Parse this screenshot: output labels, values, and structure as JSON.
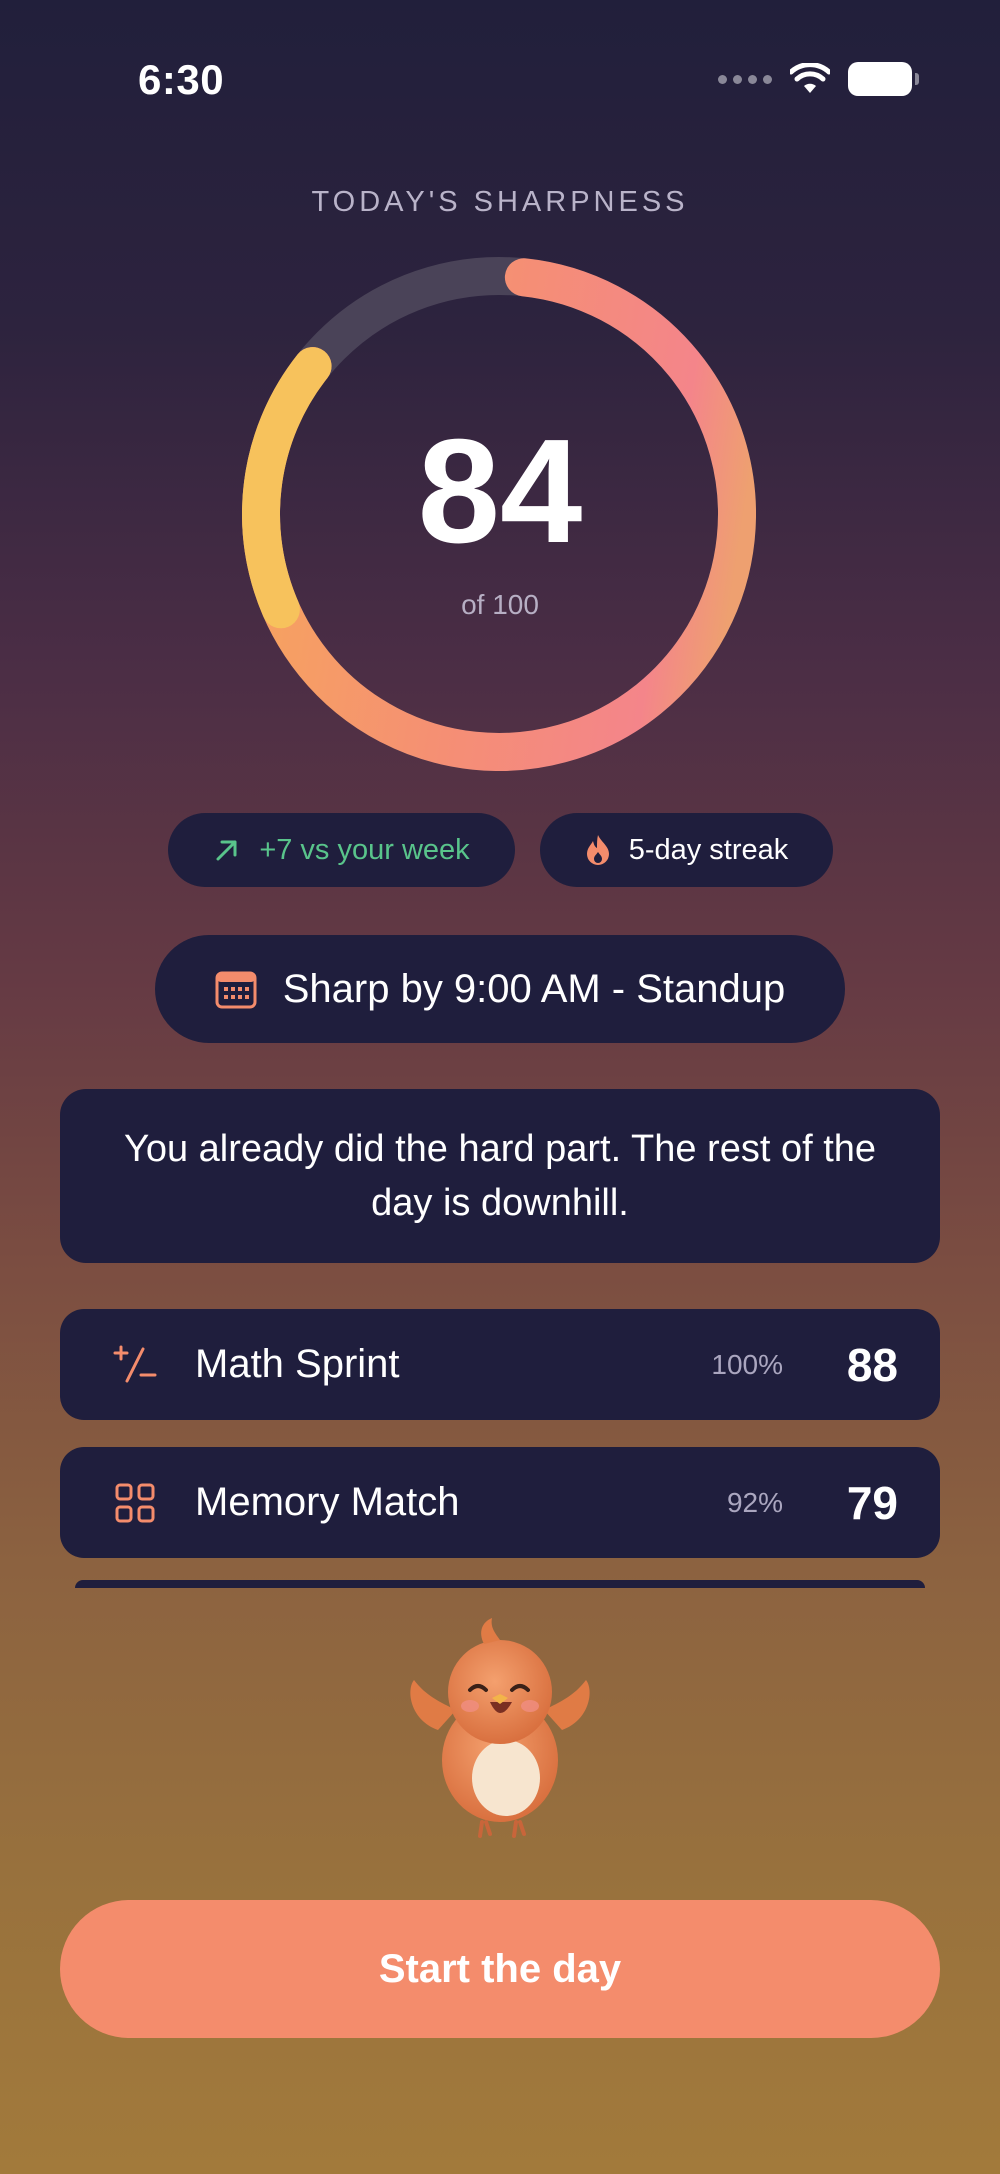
{
  "status_bar": {
    "time": "6:30",
    "icons": [
      "signal-dots-icon",
      "wifi-icon",
      "battery-icon"
    ]
  },
  "header": {
    "title": "TODAY'S SHARPNESS"
  },
  "score": {
    "value": "84",
    "subtitle": "of 100",
    "fraction": 0.84
  },
  "badges": {
    "trend": {
      "icon": "arrow-up-right-icon",
      "label": "+7 vs your week"
    },
    "streak": {
      "icon": "flame-icon",
      "label": "5-day streak"
    }
  },
  "deadline": {
    "icon": "calendar-icon",
    "label": "Sharp by 9:00 AM - Standup"
  },
  "message": "You already did the hard part. The rest of the day is downhill.",
  "games": [
    {
      "icon": "plus-minus-icon",
      "name": "Math Sprint",
      "percent": "100%",
      "score": "88"
    },
    {
      "icon": "grid-icon",
      "name": "Memory Match",
      "percent": "92%",
      "score": "79"
    }
  ],
  "mascot": {
    "icon": "bird-mascot-icon"
  },
  "cta": {
    "label": "Start the day"
  },
  "colors": {
    "accent": "#f48c6c",
    "card": "#1f1e3d",
    "positive": "#59c48b",
    "ring_gold": "#f7c25c",
    "ring_orange": "#f6a262",
    "ring_pink": "#f4858a",
    "ring_track": "#4a4358"
  }
}
